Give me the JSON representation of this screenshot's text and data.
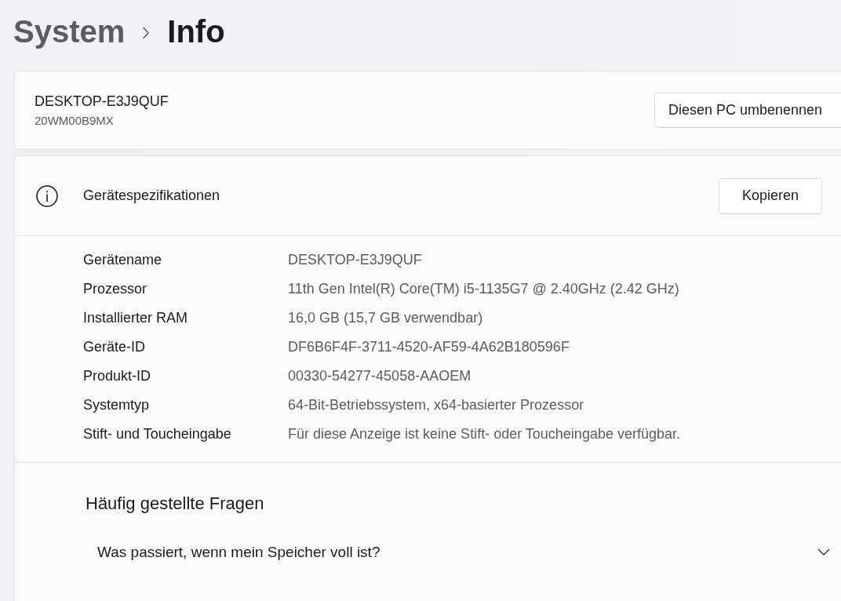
{
  "breadcrumb": [
    {
      "label": "System",
      "current": false
    },
    {
      "label": "Info",
      "current": true
    }
  ],
  "device": {
    "name": "DESKTOP-E3J9QUF",
    "model": "20WM00B9MX",
    "rename_button": "Diesen PC umbenennen"
  },
  "specifications": {
    "title": "Gerätespezifikationen",
    "copy_button": "Kopieren",
    "rows": [
      {
        "label": "Gerätename",
        "value": "DESKTOP-E3J9QUF"
      },
      {
        "label": "Prozessor",
        "value": "11th Gen Intel(R) Core(TM) i5-1135G7 @ 2.40GHz (2.42 GHz)"
      },
      {
        "label": "Installierter RAM",
        "value": "16,0 GB (15,7 GB verwendbar)"
      },
      {
        "label": "Geräte-ID",
        "value": "DF6B6F4F-3711-4520-AF59-4A62B180596F"
      },
      {
        "label": "Produkt-ID",
        "value": "00330-54277-45058-AAOEM"
      },
      {
        "label": "Systemtyp",
        "value": "64-Bit-Betriebssystem, x64-basierter Prozessor"
      },
      {
        "label": "Stift- und Toucheingabe",
        "value": "Für diese Anzeige ist keine Stift- oder Toucheingabe verfügbar."
      }
    ]
  },
  "faq": {
    "title": "Häufig gestellte Fragen",
    "questions": [
      {
        "text": "Was passiert, wenn mein Speicher voll ist?",
        "expanded": false
      }
    ]
  }
}
